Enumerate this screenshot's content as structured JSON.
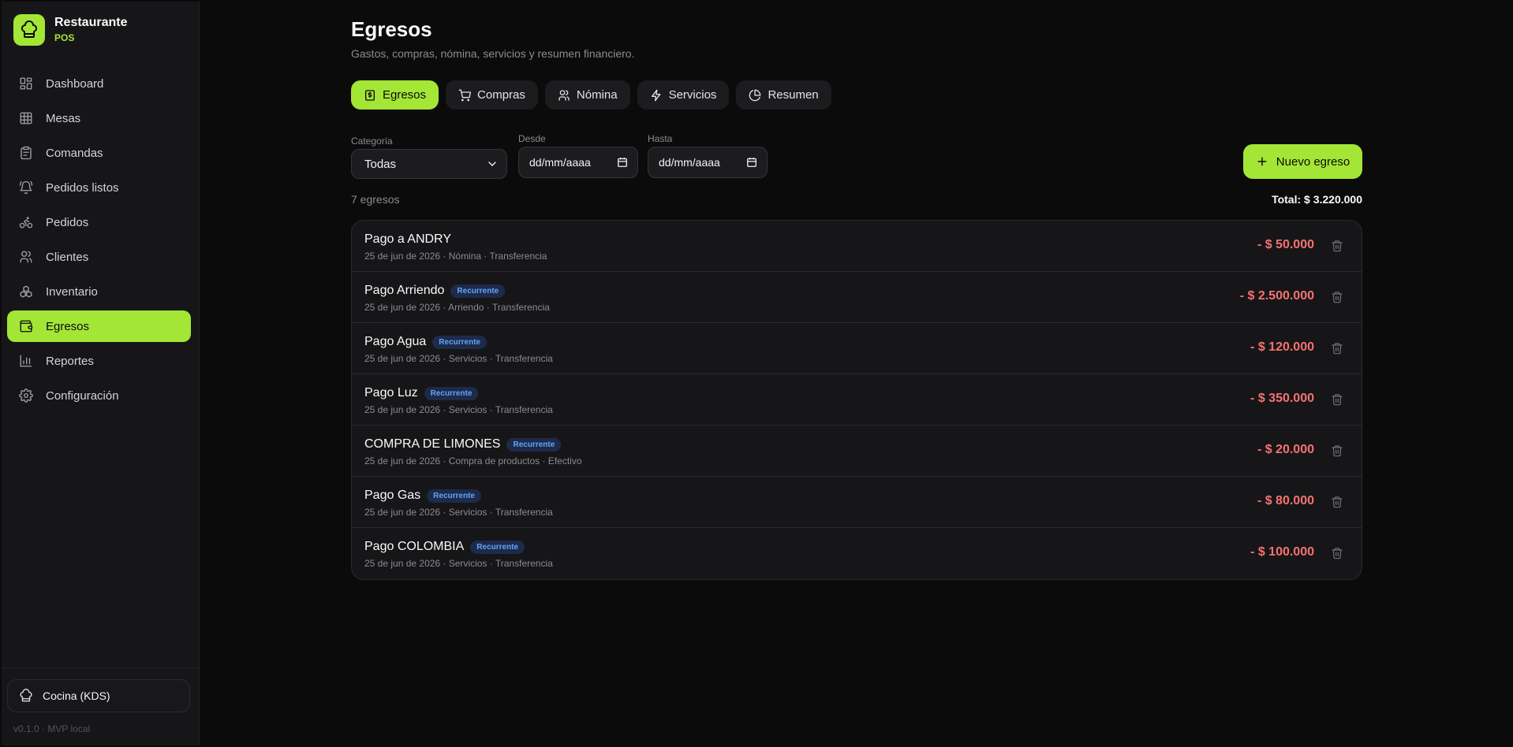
{
  "brand": {
    "title": "Restaurante",
    "subtitle": "POS"
  },
  "sidebar": {
    "items": [
      {
        "label": "Dashboard",
        "icon": "dashboard-icon"
      },
      {
        "label": "Mesas",
        "icon": "grid-icon"
      },
      {
        "label": "Comandas",
        "icon": "clipboard-icon"
      },
      {
        "label": "Pedidos listos",
        "icon": "bell-icon"
      },
      {
        "label": "Pedidos",
        "icon": "bike-icon"
      },
      {
        "label": "Clientes",
        "icon": "users-icon"
      },
      {
        "label": "Inventario",
        "icon": "boxes-icon"
      },
      {
        "label": "Egresos",
        "icon": "wallet-icon",
        "active": true
      },
      {
        "label": "Reportes",
        "icon": "bar-chart-icon"
      },
      {
        "label": "Configuración",
        "icon": "gear-icon"
      }
    ],
    "kds_label": "Cocina (KDS)",
    "version": "v0.1.0 · MVP local"
  },
  "page": {
    "title": "Egresos",
    "subtitle": "Gastos, compras, nómina, servicios y resumen financiero."
  },
  "tabs": [
    {
      "label": "Egresos",
      "icon": "receipt-icon",
      "active": true
    },
    {
      "label": "Compras",
      "icon": "cart-icon"
    },
    {
      "label": "Nómina",
      "icon": "users-icon"
    },
    {
      "label": "Servicios",
      "icon": "bolt-icon"
    },
    {
      "label": "Resumen",
      "icon": "pie-chart-icon"
    }
  ],
  "filters": {
    "category_label": "Categoría",
    "category_value": "Todas",
    "from_label": "Desde",
    "from_value": "dd/mm/aaaa",
    "to_label": "Hasta",
    "to_value": "dd/mm/aaaa"
  },
  "new_button": "Nuevo egreso",
  "summary": {
    "count": "7 egresos",
    "total": "Total: $ 3.220.000"
  },
  "expenses": [
    {
      "name": "Pago a ANDRY",
      "badge": "",
      "meta": "25 de jun de 2026 · Nómina · Transferencia",
      "amount": "- $ 50.000"
    },
    {
      "name": "Pago Arriendo",
      "badge": "Recurrente",
      "meta": "25 de jun de 2026 · Arriendo · Transferencia",
      "amount": "- $ 2.500.000"
    },
    {
      "name": "Pago Agua",
      "badge": "Recurrente",
      "meta": "25 de jun de 2026 · Servicios · Transferencia",
      "amount": "- $ 120.000"
    },
    {
      "name": "Pago Luz",
      "badge": "Recurrente",
      "meta": "25 de jun de 2026 · Servicios · Transferencia",
      "amount": "- $ 350.000"
    },
    {
      "name": "COMPRA DE LIMONES",
      "badge": "Recurrente",
      "meta": "25 de jun de 2026 · Compra de productos · Efectivo",
      "amount": "- $ 20.000"
    },
    {
      "name": "Pago Gas",
      "badge": "Recurrente",
      "meta": "25 de jun de 2026 · Servicios · Transferencia",
      "amount": "- $ 80.000"
    },
    {
      "name": "Pago COLOMBIA",
      "badge": "Recurrente",
      "meta": "25 de jun de 2026 · Servicios · Transferencia",
      "amount": "- $ 100.000"
    }
  ],
  "colors": {
    "accent": "#a3e635",
    "negative": "#f87171",
    "badge_text": "#60a5fa",
    "background": "#0b0b0c",
    "sidebar": "#161618"
  }
}
